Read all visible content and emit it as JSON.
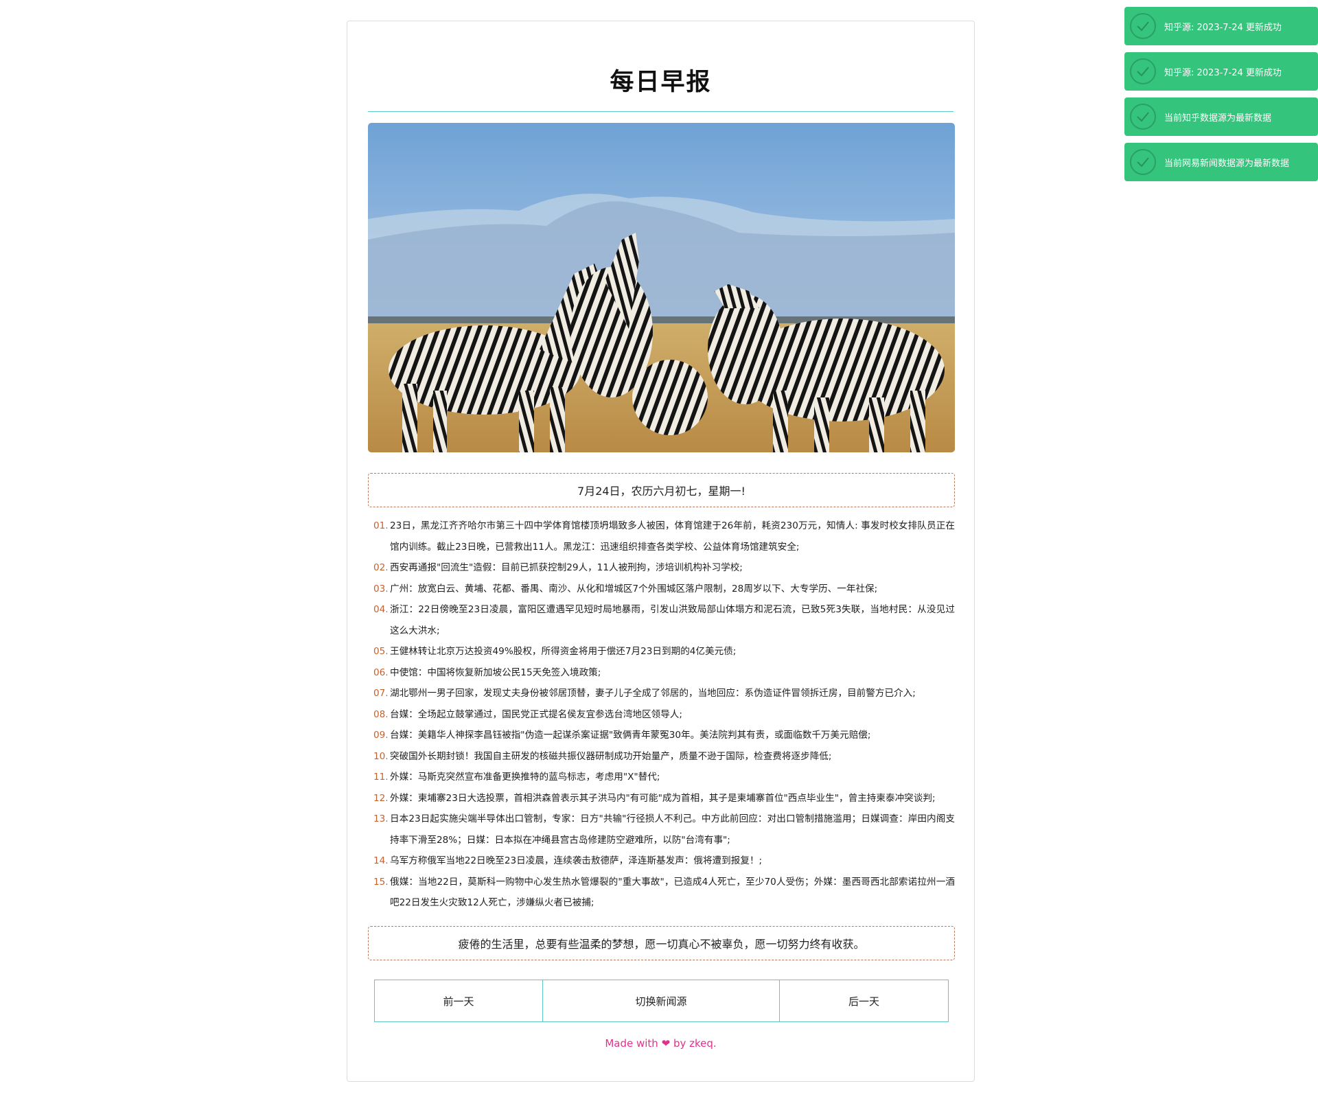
{
  "page": {
    "title": "每日早报",
    "date_line": "7月24日，农历六月初七，星期一!",
    "quote": "疲倦的生活里，总要有些温柔的梦想，愿一切真心不被辜负，愿一切努力终有收获。",
    "hero_image": "zebras-on-savanna"
  },
  "news": [
    {
      "num": "01.",
      "text": "23日，黑龙江齐齐哈尔市第三十四中学体育馆楼顶坍塌致多人被困，体育馆建于26年前，耗资230万元，知情人: 事发时校女排队员正在馆内训练。截止23日晚，已营救出11人。黑龙江：迅速组织排查各类学校、公益体育场馆建筑安全;"
    },
    {
      "num": "02.",
      "text": "西安再通报\"回流生\"造假：目前已抓获控制29人，11人被刑拘，涉培训机构补习学校;"
    },
    {
      "num": "03.",
      "text": "广州：放宽白云、黄埔、花都、番禺、南沙、从化和增城区7个外围城区落户限制，28周岁以下、大专学历、一年社保;"
    },
    {
      "num": "04.",
      "text": "浙江：22日傍晚至23日凌晨，富阳区遭遇罕见短时局地暴雨，引发山洪致局部山体塌方和泥石流，已致5死3失联，当地村民：从没见过这么大洪水;"
    },
    {
      "num": "05.",
      "text": "王健林转让北京万达投资49%股权，所得资金将用于偿还7月23日到期的4亿美元债;"
    },
    {
      "num": "06.",
      "text": "中使馆：中国将恢复新加坡公民15天免签入境政策;"
    },
    {
      "num": "07.",
      "text": "湖北鄂州一男子回家，发现丈夫身份被邻居顶替，妻子儿子全成了邻居的，当地回应：系伪造证件冒领拆迁房，目前警方已介入;"
    },
    {
      "num": "08.",
      "text": "台媒：全场起立鼓掌通过，国民党正式提名侯友宜参选台湾地区领导人;"
    },
    {
      "num": "09.",
      "text": "台媒：美籍华人神探李昌钰被指\"伪造一起谋杀案证据\"致俩青年蒙冤30年。美法院判其有责，或面临数千万美元赔偿;"
    },
    {
      "num": "10.",
      "text": "突破国外长期封锁！我国自主研发的核磁共振仪器研制成功开始量产，质量不逊于国际，检查费将逐步降低;"
    },
    {
      "num": "11.",
      "text": "外媒：马斯克突然宣布准备更换推特的蓝鸟标志，考虑用\"X\"替代;"
    },
    {
      "num": "12.",
      "text": "外媒：柬埔寨23日大选投票，首相洪森曾表示其子洪马内\"有可能\"成为首相，其子是柬埔寨首位\"西点毕业生\"，曾主持柬泰冲突谈判;"
    },
    {
      "num": "13.",
      "text": "日本23日起实施尖端半导体出口管制，专家：日方\"共输\"行径损人不利己。中方此前回应：对出口管制措施滥用；日媒调查：岸田内阁支持率下滑至28%；日媒：日本拟在冲绳县宫古岛修建防空避难所，以防\"台湾有事\";"
    },
    {
      "num": "14.",
      "text": "乌军方称俄军当地22日晚至23日凌晨，连续袭击敖德萨，泽连斯基发声：俄将遭到报复！;"
    },
    {
      "num": "15.",
      "text": "俄媒：当地22日，莫斯科一购物中心发生热水管爆裂的\"重大事故\"，已造成4人死亡，至少70人受伤；外媒：墨西哥西北部索诺拉州一酒吧22日发生火灾致12人死亡，涉嫌纵火者已被捕;"
    }
  ],
  "buttons": {
    "prev": "前一天",
    "switch": "切换新闻源",
    "next": "后一天"
  },
  "footer": {
    "before": "Made with",
    "heart": "❤",
    "after": "by zkeq."
  },
  "toasts": [
    {
      "text": "知乎源: 2023-7-24 更新成功",
      "icon": "check-circle-icon"
    },
    {
      "text": "知乎源: 2023-7-24 更新成功",
      "icon": "check-circle-icon"
    },
    {
      "text": "当前知乎数据源为最新数据",
      "icon": "check-circle-icon"
    },
    {
      "text": "当前网易新闻数据源为最新数据",
      "icon": "check-circle-icon"
    }
  ],
  "colors": {
    "accent_teal": "#5cc7c9",
    "number_orange": "#c4622d",
    "footer_pink": "#e0318a",
    "toast_green": "#34c47b"
  }
}
